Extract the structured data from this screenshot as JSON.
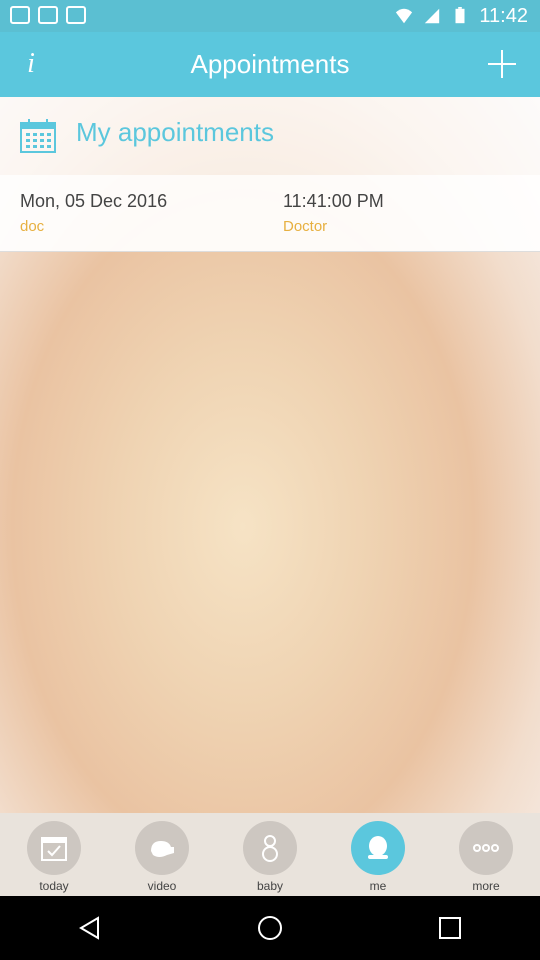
{
  "status_bar": {
    "time": "11:42"
  },
  "top_bar": {
    "title": "Appointments",
    "info_label": "i"
  },
  "header": {
    "label": "My appointments"
  },
  "appointment": {
    "date": "Mon, 05 Dec 2016",
    "type": "doc",
    "time": "11:41:00 PM",
    "category": "Doctor"
  },
  "tabs": [
    {
      "label": "today",
      "icon": "calendar-check-icon",
      "active": false
    },
    {
      "label": "video",
      "icon": "video-icon",
      "active": false
    },
    {
      "label": "baby",
      "icon": "baby-icon",
      "active": false
    },
    {
      "label": "me",
      "icon": "person-icon",
      "active": true
    },
    {
      "label": "more",
      "icon": "more-icon",
      "active": false
    }
  ],
  "colors": {
    "accent": "#5bc7dd",
    "secondary": "#e7b040"
  }
}
